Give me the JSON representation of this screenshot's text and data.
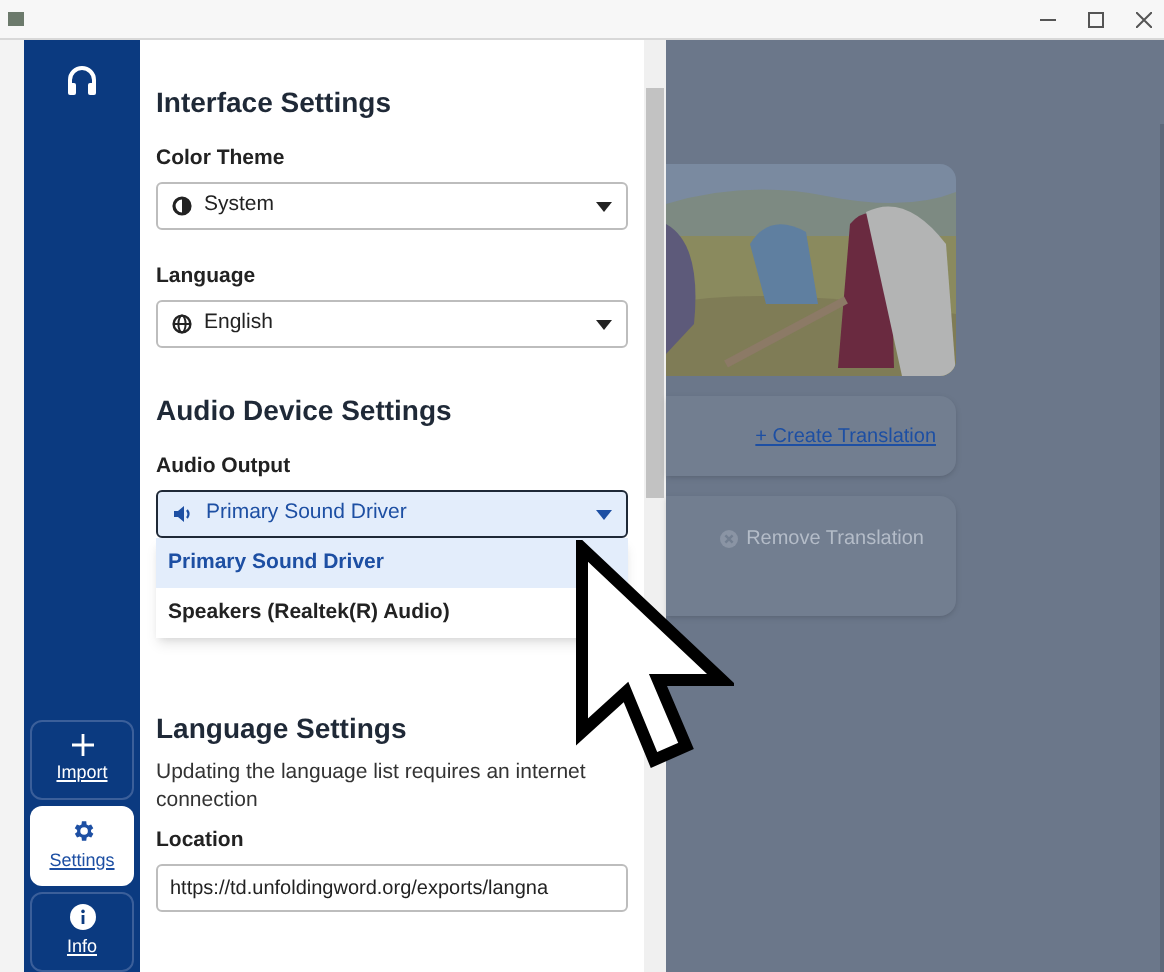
{
  "sidebar": {
    "items": [
      {
        "label": "Import",
        "selected": false
      },
      {
        "label": "Settings",
        "selected": true
      },
      {
        "label": "Info",
        "selected": false
      }
    ]
  },
  "settings": {
    "sections": [
      {
        "title": "Interface Settings",
        "fields": [
          {
            "label": "Color Theme",
            "kind": "select",
            "value": "System",
            "focused": false
          },
          {
            "label": "Language",
            "kind": "select",
            "value": "English",
            "focused": false
          }
        ]
      },
      {
        "title": "Audio Device Settings",
        "fields": [
          {
            "label": "Audio Output",
            "kind": "select",
            "value": "Primary Sound Driver",
            "focused": true,
            "options": [
              {
                "label": "Primary Sound Driver",
                "selected": true
              },
              {
                "label": "Speakers (Realtek(R) Audio)",
                "selected": false
              }
            ]
          }
        ]
      },
      {
        "title": "Language Settings",
        "description": "Updating the language list requires an internet connection",
        "fields": [
          {
            "label": "Location",
            "kind": "input",
            "value": "https://td.unfoldingword.org/exports/langna"
          }
        ]
      }
    ]
  },
  "background": {
    "create_button": "+ Create Translation",
    "remove_button": {
      "label": "Remove Translation",
      "disabled": true
    }
  }
}
